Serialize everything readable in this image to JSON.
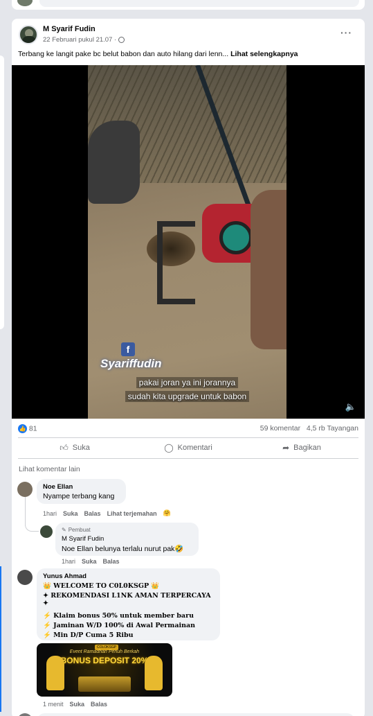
{
  "post": {
    "author": "M Syarif Fudin",
    "timestamp": "22 Februari pukul 21.07 ·",
    "more_label": "···",
    "caption": "Terbang ke langit pake bc belut babon dan auto hilang dari lenn...",
    "see_more": "Lihat selengkapnya"
  },
  "video": {
    "watermark": "Syariffudin",
    "watermark_icon": "f",
    "subtitle_line1": "pakai joran ya ini jorannya",
    "subtitle_line2": "sudah kita upgrade untuk babon",
    "mute_icon": "🔈"
  },
  "stats": {
    "likes": "81",
    "comments": "59 komentar",
    "views": "4,5 rb Tayangan"
  },
  "actions": {
    "like": "Suka",
    "comment": "Komentari",
    "share": "Bagikan"
  },
  "comments": {
    "see_more": "Lihat komentar lain",
    "items": [
      {
        "name": "Noe Ellan",
        "text": "Nyampe terbang kang",
        "time": "1hari",
        "like": "Suka",
        "reply": "Balas",
        "translate": "Lihat terjemahan",
        "reaction": "🤗"
      },
      {
        "badge": "Pembuat",
        "name": "M Syarif Fudin",
        "text": "Noe Ellan belunya terlalu nurut pak🤣",
        "time": "1hari",
        "like": "Suka",
        "reply": "Balas"
      },
      {
        "name": "Yunus Ahmad",
        "lines": [
          "👑 WELCOME TO C0L0KSGP 👑",
          "✦ REKOMENDASI L1NK AMAN TERPERCAYA ✦",
          "⚡ Klaim bonus 50% untuk member baru",
          "⚡ Jaminan W/D 100% di Awal Permainan",
          "⚡ Min D/P Cuma 5 Ribu"
        ],
        "banner_tag": "COLOKSGP",
        "banner_subtitle": "Event Ramadhan Penuh Berkah",
        "banner_title": "BONUS DEPOSIT 20%",
        "time": "1 menit",
        "like": "Suka",
        "reply": "Balas"
      }
    ]
  }
}
